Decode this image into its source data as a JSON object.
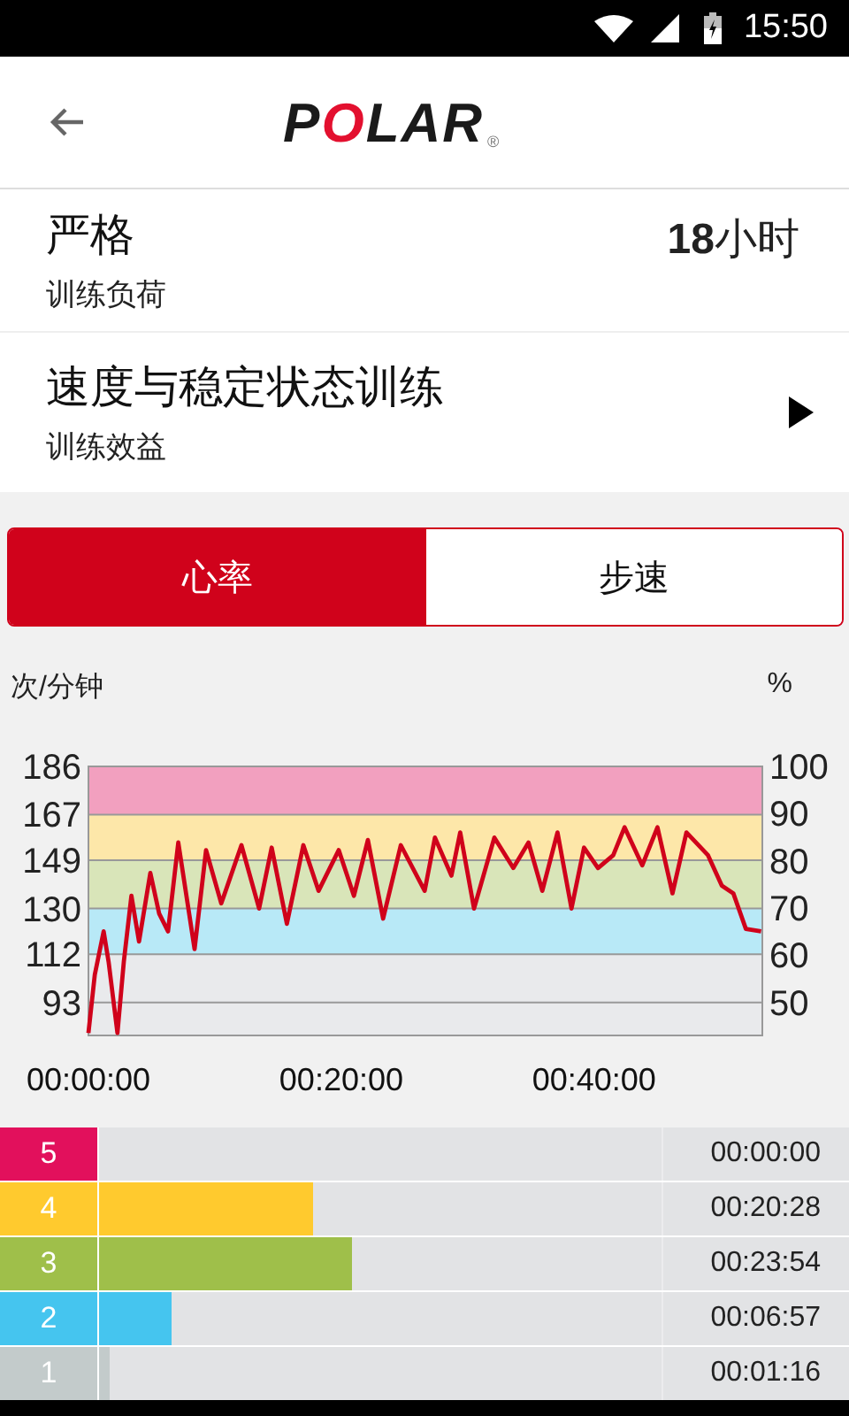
{
  "status_bar": {
    "time": "15:50"
  },
  "header": {
    "logo": "POLAR",
    "logo_mark": "®"
  },
  "summary_rows": [
    {
      "kind": "value",
      "title": "严格",
      "subtitle": "训练负荷",
      "value": "**18**小时"
    },
    {
      "kind": "link",
      "title": "速度与稳定状态训练",
      "subtitle": "训练效益"
    }
  ],
  "tabs": [
    {
      "label": "心率",
      "selected": true
    },
    {
      "label": "步速",
      "selected": false
    }
  ],
  "chart": {
    "chart_data": {
      "type": "line",
      "ylabel": "次/分钟",
      "y2label": "%",
      "x": [
        0,
        0.5,
        1.2,
        1.6,
        2.3,
        2.8,
        3.4,
        4.0,
        4.9,
        5.6,
        6.3,
        7.1,
        8.4,
        9.3,
        10.5,
        12.1,
        13.5,
        14.5,
        15.7,
        17.0,
        18.2,
        19.8,
        21.0,
        22.1,
        23.3,
        24.7,
        26.6,
        27.4,
        28.7,
        29.4,
        30.5,
        32.1,
        33.6,
        34.8,
        35.9,
        37.1,
        38.2,
        39.2,
        40.3,
        41.5,
        42.4,
        43.8,
        45.0,
        46.2,
        47.3,
        49.0,
        50.1,
        51.0,
        52.0,
        53.2
      ],
      "series": [
        {
          "color": "#d0021b",
          "values": [
            81,
            104,
            121,
            109,
            81,
            109,
            135,
            117,
            144,
            128,
            121,
            156,
            114,
            153,
            132,
            155,
            130,
            154,
            124,
            155,
            137,
            153,
            135,
            157,
            126,
            155,
            137,
            158,
            143,
            160,
            130,
            158,
            146,
            156,
            137,
            160,
            130,
            154,
            146,
            151,
            162,
            147,
            162,
            136,
            160,
            151,
            139,
            136,
            122,
            121
          ]
        }
      ],
      "xlim": [
        0,
        53.3
      ],
      "ylim": [
        80,
        186
      ],
      "xticks": [
        {
          "value": 0,
          "label": "00:00:00"
        },
        {
          "value": 20,
          "label": "00:20:00"
        },
        {
          "value": 40,
          "label": "00:40:00"
        }
      ],
      "yticks": [
        186,
        167,
        149,
        130,
        112,
        93
      ],
      "grid": true,
      "bands": [
        {
          "axis": "y",
          "from": 167,
          "to": 186,
          "color": "#f2a0bf"
        },
        {
          "axis": "y",
          "from": 149,
          "to": 167,
          "color": "#fde7a9"
        },
        {
          "axis": "y",
          "from": 130,
          "to": 149,
          "color": "#d9e5b9"
        },
        {
          "axis": "y",
          "from": 112,
          "to": 130,
          "color": "#b8e9f7"
        },
        {
          "axis": "y",
          "from": 80,
          "to": 112,
          "color": "#e9eaec"
        }
      ],
      "y2lim": [
        43,
        100
      ],
      "y2ticks": [
        100,
        90,
        80,
        70,
        60,
        50
      ]
    }
  },
  "zones": [
    {
      "label": "5",
      "color": "#e2105c",
      "level": 0,
      "time": "00:00:00"
    },
    {
      "label": "4",
      "color": "#ffca2e",
      "level": 0.38,
      "time": "00:20:28"
    },
    {
      "label": "3",
      "color": "#9fbf4a",
      "level": 0.45,
      "time": "00:23:54"
    },
    {
      "label": "2",
      "color": "#45c5ef",
      "level": 0.13,
      "time": "00:06:57"
    },
    {
      "label": "1",
      "color": "#c3cbcb",
      "level": 0.02,
      "time": "00:01:16"
    }
  ]
}
